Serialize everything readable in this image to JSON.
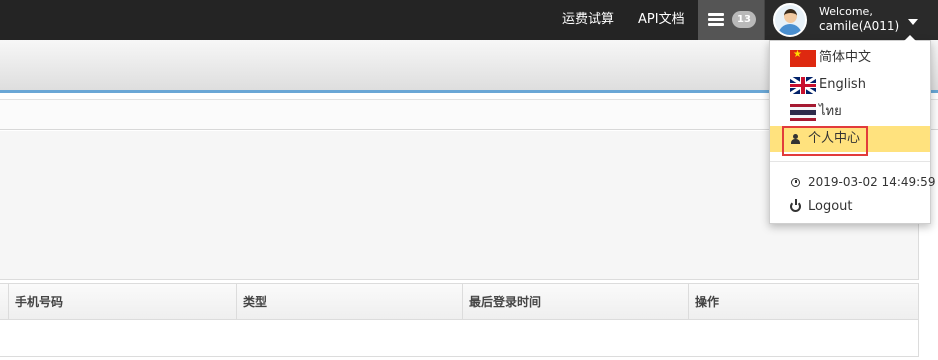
{
  "topbar": {
    "links": [
      "运费试算",
      "API文档"
    ],
    "message_count": "13",
    "user": {
      "welcome": "Welcome,",
      "name": "camile(A011)"
    }
  },
  "table": {
    "headers": [
      "手机号码",
      "类型",
      "最后登录时间",
      "操作"
    ]
  },
  "dropdown": {
    "languages": [
      {
        "label": "简体中文",
        "flag": "flag-cn-icon"
      },
      {
        "label": "English",
        "flag": "flag-gb-icon"
      },
      {
        "label": "ไทย",
        "flag": "flag-th-icon"
      }
    ],
    "profile_label": "个人中心",
    "login_time": "2019-03-02 14:49:59",
    "logout_label": "Logout"
  },
  "colors": {
    "topbar_bg": "#242424",
    "accent_line": "#6aa7d6",
    "highlight": "#ffe27e",
    "callout_border": "#e23b3b"
  }
}
